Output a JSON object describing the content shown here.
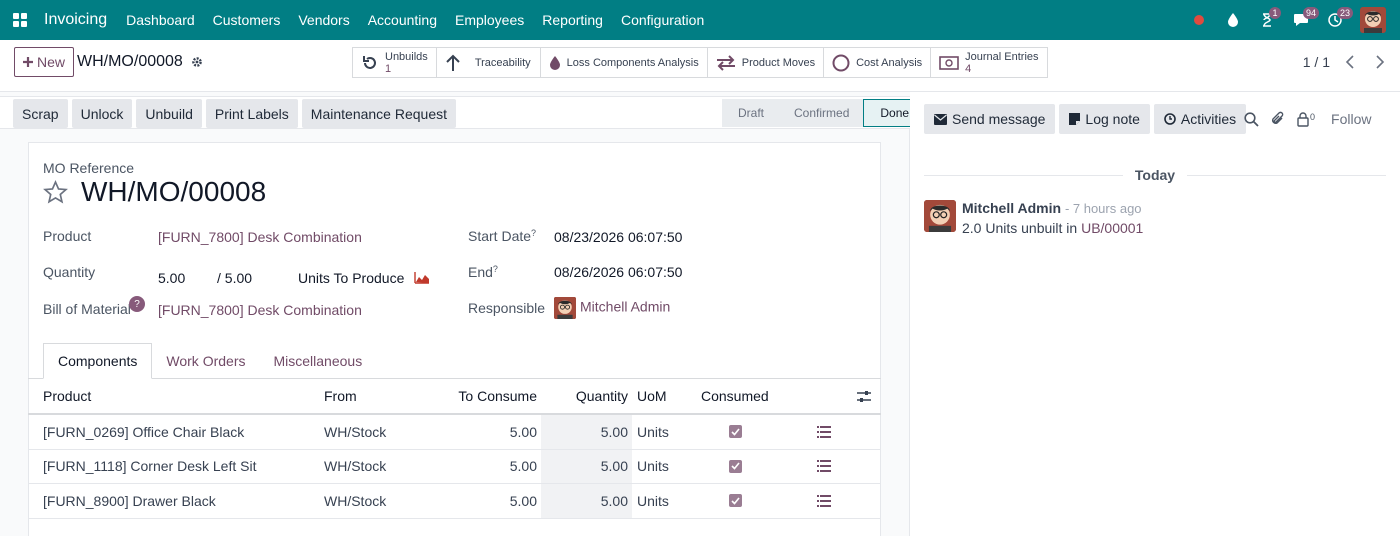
{
  "navbar": {
    "app_name": "Invoicing",
    "menu": [
      "Dashboard",
      "Customers",
      "Vendors",
      "Accounting",
      "Employees",
      "Reporting",
      "Configuration"
    ],
    "badges": {
      "activity": "1",
      "messages": "94",
      "clock": "23"
    }
  },
  "control": {
    "new_label": "New",
    "record_name": "WH/MO/00008",
    "smart_buttons": [
      {
        "label": "Unbuilds",
        "value": "1",
        "icon": "undo-icon"
      },
      {
        "label": "Traceability",
        "icon": "arrow-up-icon"
      },
      {
        "label": "Loss Components Analysis",
        "icon": "drop-icon"
      },
      {
        "label": "Product Moves",
        "icon": "exchange-icon"
      },
      {
        "label": "Cost Analysis",
        "icon": "circle-icon"
      },
      {
        "label": "Journal Entries",
        "value": "4",
        "icon": "money-icon"
      }
    ],
    "pager": "1 / 1"
  },
  "statusbar": {
    "actions": [
      "Scrap",
      "Unlock",
      "Unbuild",
      "Print Labels",
      "Maintenance Request"
    ],
    "stages": [
      "Draft",
      "Confirmed",
      "Done"
    ],
    "active_stage": "Done"
  },
  "form": {
    "ref_label": "MO Reference",
    "ref_value": "WH/MO/00008",
    "product_label": "Product",
    "product_value": "[FURN_7800] Desk Combination",
    "quantity_label": "Quantity",
    "quantity_value": "5.00",
    "quantity_total": "/ 5.00",
    "quantity_unit": "Units To Produce",
    "bom_label": "Bill of Material",
    "bom_value": "[FURN_7800] Desk Combination",
    "start_label": "Start Date",
    "start_value": "08/23/2026 06:07:50",
    "end_label": "End",
    "end_value": "08/26/2026 06:07:50",
    "responsible_label": "Responsible",
    "responsible_value": "Mitchell Admin",
    "help_mark": "?"
  },
  "tabs": [
    "Components",
    "Work Orders",
    "Miscellaneous"
  ],
  "table": {
    "headers": {
      "product": "Product",
      "from": "From",
      "to_consume": "To Consume",
      "quantity": "Quantity",
      "uom": "UoM",
      "consumed": "Consumed"
    },
    "rows": [
      {
        "product": "[FURN_0269] Office Chair Black",
        "from": "WH/Stock",
        "to_consume": "5.00",
        "quantity": "5.00",
        "uom": "Units"
      },
      {
        "product": "[FURN_1118] Corner Desk Left Sit",
        "from": "WH/Stock",
        "to_consume": "5.00",
        "quantity": "5.00",
        "uom": "Units"
      },
      {
        "product": "[FURN_8900] Drawer Black",
        "from": "WH/Stock",
        "to_consume": "5.00",
        "quantity": "5.00",
        "uom": "Units"
      }
    ]
  },
  "chatter": {
    "send_message": "Send message",
    "log_note": "Log note",
    "activities": "Activities",
    "followers_count": "0",
    "follow": "Follow",
    "today": "Today",
    "message": {
      "author": "Mitchell Admin",
      "time": "- 7 hours ago",
      "body_prefix": "2.0 Units unbuilt in",
      "body_link": "UB/00001"
    }
  },
  "colors": {
    "navbar": "#017e84",
    "brand": "#714b67",
    "badge": "#875a7b"
  }
}
